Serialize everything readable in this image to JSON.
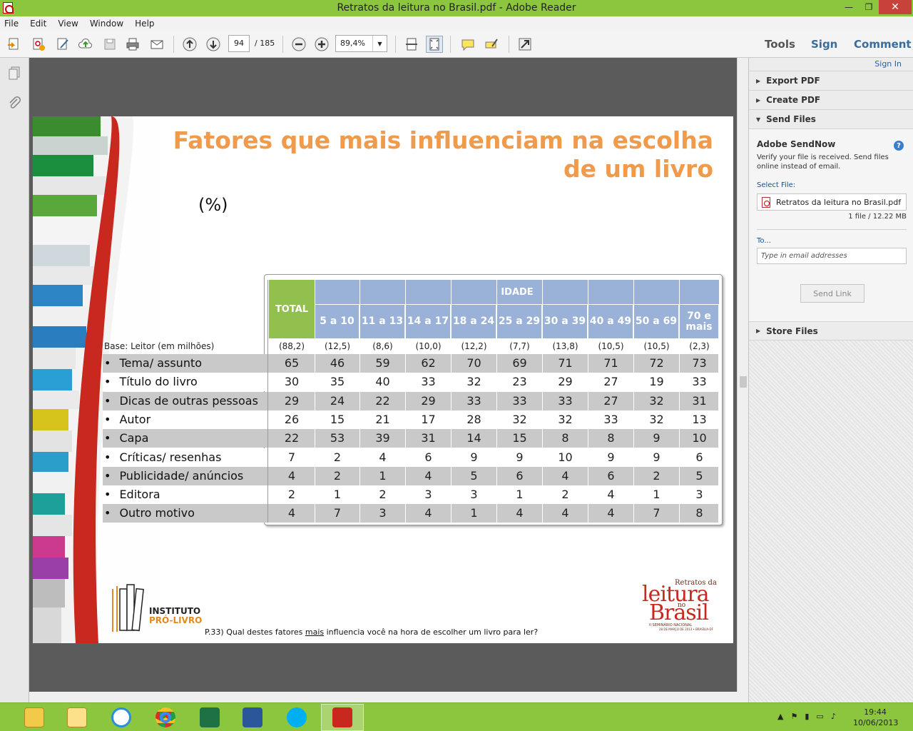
{
  "window": {
    "title": "Retratos da leitura no Brasil.pdf - Adobe Reader",
    "minimize": "—",
    "maximize": "❐",
    "close": "✕"
  },
  "menu": [
    "File",
    "Edit",
    "View",
    "Window",
    "Help"
  ],
  "toolbar": {
    "page_current": "94",
    "page_total": "/ 185",
    "zoom": "89,4%",
    "tabs": {
      "tools": "Tools",
      "sign": "Sign",
      "comment": "Comment"
    }
  },
  "slide": {
    "title_line1": "Fatores que mais influenciam na escolha",
    "title_line2": "de um livro",
    "unit": "(%)",
    "header_total": "TOTAL",
    "header_idade": "IDADE",
    "age_groups": [
      "5 a 10",
      "11 a 13",
      "14 a 17",
      "18 a 24",
      "25 a 29",
      "30 a 39",
      "40 a 49",
      "50 a 69",
      "70 e mais"
    ],
    "base_label": "Base: Leitor (em milhões)",
    "base_values": [
      "(88,2)",
      "(12,5)",
      "(8,6)",
      "(10,0)",
      "(12,2)",
      "(7,7)",
      "(13,8)",
      "(10,5)",
      "(10,5)",
      "(2,3)"
    ],
    "rows": [
      {
        "label": "Tema/ assunto",
        "values": [
          "65",
          "46",
          "59",
          "62",
          "70",
          "69",
          "71",
          "71",
          "72",
          "73"
        ]
      },
      {
        "label": "Título do livro",
        "values": [
          "30",
          "35",
          "40",
          "33",
          "32",
          "23",
          "29",
          "27",
          "19",
          "33"
        ]
      },
      {
        "label": "Dicas de outras pessoas",
        "values": [
          "29",
          "24",
          "22",
          "29",
          "33",
          "33",
          "33",
          "27",
          "32",
          "31"
        ]
      },
      {
        "label": "Autor",
        "values": [
          "26",
          "15",
          "21",
          "17",
          "28",
          "32",
          "32",
          "33",
          "32",
          "13"
        ]
      },
      {
        "label": "Capa",
        "values": [
          "22",
          "53",
          "39",
          "31",
          "14",
          "15",
          "8",
          "8",
          "9",
          "10"
        ]
      },
      {
        "label": "Críticas/ resenhas",
        "values": [
          "7",
          "2",
          "4",
          "6",
          "9",
          "9",
          "10",
          "9",
          "9",
          "6"
        ]
      },
      {
        "label": "Publicidade/ anúncios",
        "values": [
          "4",
          "2",
          "1",
          "4",
          "5",
          "6",
          "4",
          "6",
          "2",
          "5"
        ]
      },
      {
        "label": "Editora",
        "values": [
          "2",
          "1",
          "2",
          "3",
          "3",
          "1",
          "2",
          "4",
          "1",
          "3"
        ]
      },
      {
        "label": "Outro motivo",
        "values": [
          "4",
          "7",
          "3",
          "4",
          "1",
          "4",
          "4",
          "4",
          "7",
          "8"
        ]
      }
    ],
    "footnote_pre": "P.33) Qual destes fatores ",
    "footnote_under": "mais",
    "footnote_post": " influencia você na hora de escolher um livro para ler?",
    "logo_ipl_line1": "INSTITUTO",
    "logo_ipl_line2": "PRÓ-LIVRO",
    "logo_brasil_top": "Retratos da",
    "logo_brasil_mid": "leitura",
    "logo_brasil_no": "no",
    "logo_brasil_bottom": "Brasil",
    "logo_brasil_sub1": "II SEMINÁRIO NACIONAL",
    "logo_brasil_sub2": "28 DE MARÇO DE 2013 • BRASÍLIA-DF"
  },
  "rightpane": {
    "signin": "Sign In",
    "export_pdf": "Export PDF",
    "create_pdf": "Create PDF",
    "send_files": "Send Files",
    "sendnow_title": "Adobe SendNow",
    "sendnow_desc": "Verify your file is received. Send files online instead of email.",
    "select_file_label": "Select File:",
    "file_name": "Retratos da leitura no Brasil.pdf",
    "file_size": "1 file / 12.22 MB",
    "to_label": "To...",
    "email_placeholder": "Type in email addresses",
    "send_link": "Send Link",
    "store_files": "Store Files"
  },
  "taskbar": {
    "time": "19:44",
    "date": "10/06/2013"
  }
}
